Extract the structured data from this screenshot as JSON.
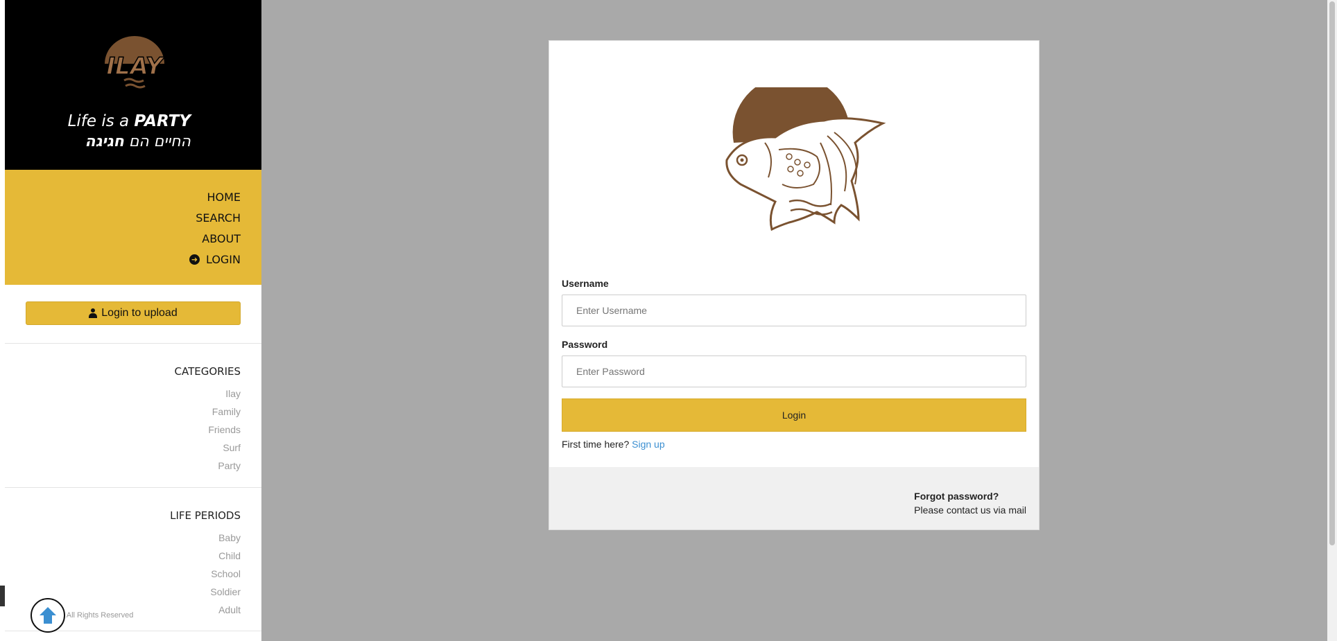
{
  "brand": {
    "logo_text": "ILAY",
    "tagline_line1_prefix": "Life is a ",
    "tagline_line1_bold": "PARTY",
    "tagline_line2_normal": "החיים הם ",
    "tagline_line2_bold": "חגיגה"
  },
  "nav": {
    "items": [
      {
        "label": "HOME"
      },
      {
        "label": "SEARCH"
      },
      {
        "label": "ABOUT"
      },
      {
        "label": "LOGIN",
        "icon": "arrow-circle-right-icon"
      }
    ]
  },
  "sidebar": {
    "upload_button": "Login to upload",
    "categories_title": "CATEGORIES",
    "categories": [
      "Ilay",
      "Family",
      "Friends",
      "Surf",
      "Party"
    ],
    "periods_title": "LIFE PERIODS",
    "periods": [
      "Baby",
      "Child",
      "School",
      "Soldier",
      "Adult"
    ],
    "copyright": "afika, All Rights Reserved"
  },
  "login": {
    "username_label": "Username",
    "username_placeholder": "Enter Username",
    "password_label": "Password",
    "password_placeholder": "Enter Password",
    "submit_label": "Login",
    "first_time_text": "First time here?",
    "signup_link": "Sign up",
    "forgot_title": "Forgot password?",
    "forgot_text": "Please contact us via mail"
  },
  "colors": {
    "accent": "#e5b937",
    "brand_brown": "#7a5230",
    "link": "#3b8fd1",
    "backdrop": "#a9a9a9"
  }
}
